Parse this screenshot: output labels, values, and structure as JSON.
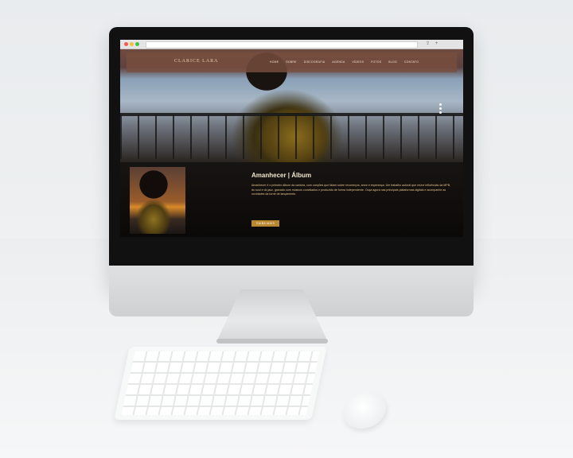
{
  "site": {
    "logo_text": "CLARICE LARA",
    "nav": [
      "HOME",
      "SOBRE",
      "DISCOGRAFIA",
      "AGENDA",
      "VÍDEOS",
      "FOTOS",
      "BLOG",
      "CONTATO"
    ]
  },
  "featured": {
    "title": "Amanhecer | Álbum",
    "description": "Amanhecer é o primeiro álbum da cantora, com canções que falam sobre recomeços, amor e esperança. Um trabalho autoral que reúne influências da MPB, do soul e do jazz, gravado com músicos convidados e produzido de forma independente. Ouça agora nas principais plataformas digitais e acompanhe as novidades da turnê de lançamento.",
    "cta_label": "SAIBA MAIS"
  },
  "icons": {
    "apple": "apple-logo-icon",
    "carousel": "carousel-dots-icon"
  },
  "colors": {
    "accent": "#b8872f",
    "nav_bg": "#784e3e",
    "text_gold": "#e8c48a"
  }
}
